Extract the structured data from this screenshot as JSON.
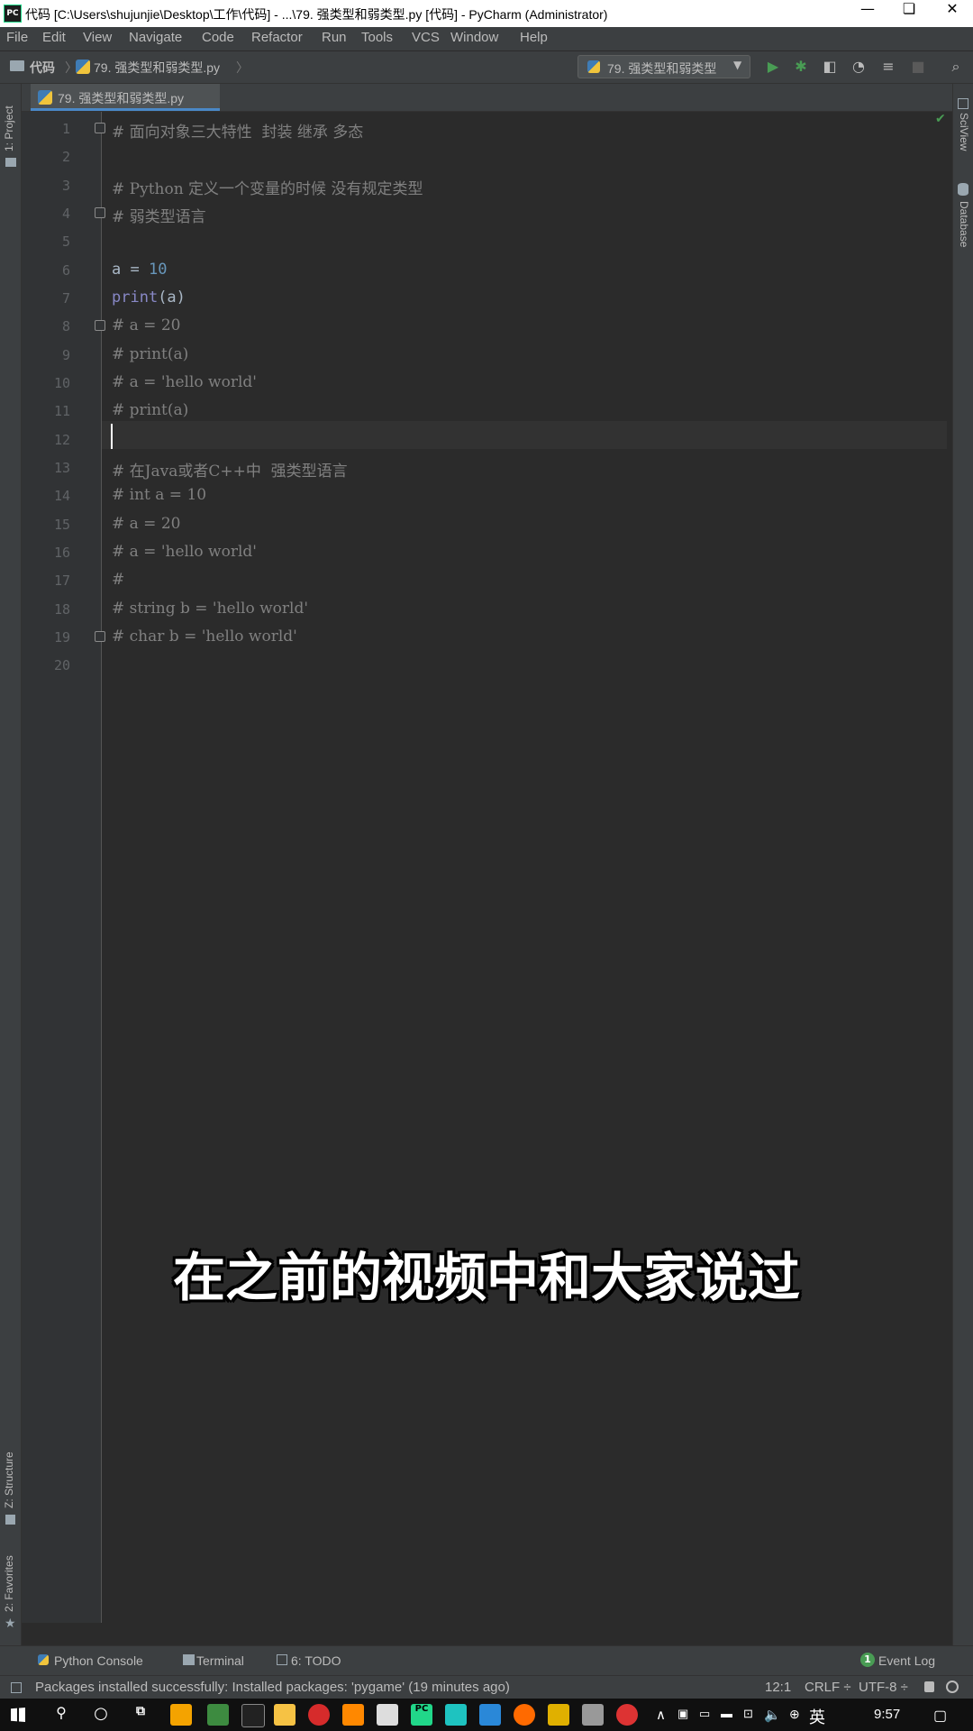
{
  "window": {
    "title": "代码 [C:\\Users\\shujunjie\\Desktop\\工作\\代码] - ...\\79. 强类型和弱类型.py [代码] - PyCharm (Administrator)",
    "app_icon_text": "PC"
  },
  "menu": [
    "File",
    "Edit",
    "View",
    "Navigate",
    "Code",
    "Refactor",
    "Run",
    "Tools",
    "VCS",
    "Window",
    "Help"
  ],
  "navbar": {
    "project": "代码",
    "file": "79. 强类型和弱类型.py",
    "run_config": "79. 强类型和弱类型"
  },
  "tab": {
    "label": "79. 强类型和弱类型.py"
  },
  "left_tools": {
    "project": "1: Project",
    "structure": "Z: Structure",
    "favorites": "2: Favorites"
  },
  "right_tools": {
    "sciview": "SciView",
    "database": "Database"
  },
  "editor": {
    "line_numbers": [
      "1",
      "2",
      "3",
      "4",
      "5",
      "6",
      "7",
      "8",
      "9",
      "10",
      "11",
      "12",
      "13",
      "14",
      "15",
      "16",
      "17",
      "18",
      "19",
      "20"
    ],
    "lines": [
      "# 面向对象三大特性  封装 继承 多态",
      "",
      "# Python 定义一个变量的时候 没有规定类型",
      "# 弱类型语言",
      "",
      "a = 10",
      "print(a)",
      "# a = 20",
      "# print(a)",
      "# a = 'hello world'",
      "# print(a)",
      "",
      "# 在Java或者C++中  强类型语言",
      "# int a = 10",
      "# a = 20",
      "# a = 'hello world'",
      "#",
      "# string b = 'hello world'",
      "# char b = 'hello world'",
      ""
    ],
    "code_tokens": {
      "a_assign": "a = ",
      "ten": "10",
      "print_fn": "print",
      "print_args": "(a)"
    }
  },
  "subtitle": "在之前的视频中和大家说过",
  "bottom_tools": {
    "python_console": "Python Console",
    "terminal": "Terminal",
    "todo": "6: TODO",
    "event_log": "Event Log",
    "event_count": "1"
  },
  "status": {
    "message": "Packages installed successfully: Installed packages: 'pygame' (19 minutes ago)",
    "position": "12:1",
    "line_sep": "CRLF ÷",
    "encoding": "UTF-8 ÷"
  },
  "taskbar": {
    "ime": "英",
    "time": "9:57"
  },
  "colors": {
    "editor_bg": "#2b2b2b",
    "chrome_bg": "#3c3f41",
    "comment": "#808080",
    "number": "#6897bb",
    "builtin": "#8888c6",
    "run_green": "#499c54"
  }
}
